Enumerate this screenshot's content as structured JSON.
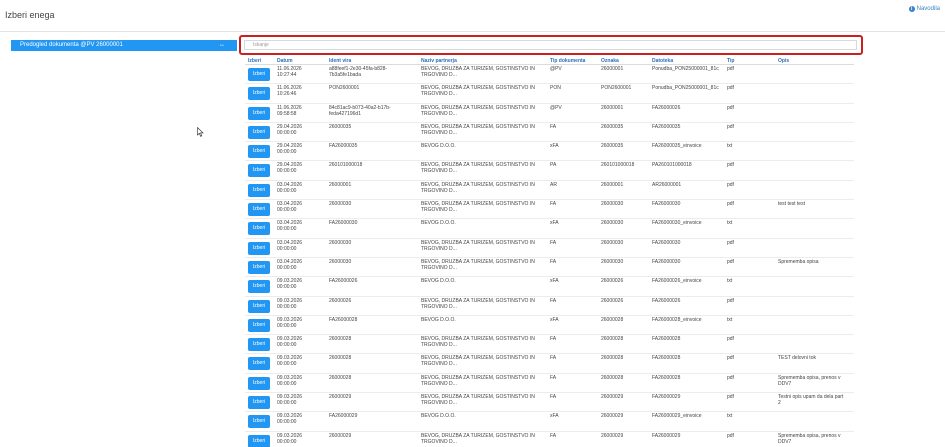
{
  "header": {
    "title": "Izberi enega",
    "help_label": "Navodila"
  },
  "preview": {
    "label": "Predogled dokumenta @PV 26000001",
    "arrows": "↔"
  },
  "search": {
    "placeholder": "Iskanje"
  },
  "table": {
    "columns": [
      "Izberi",
      "Datum",
      "Ident vira",
      "Naziv partnerja",
      "Tip dokumenta",
      "Oznaka",
      "Datoteka",
      "Tip",
      "Opis"
    ],
    "button_label": "Izberi",
    "rows": [
      {
        "date": "11.06.2026\n10:27:44",
        "ident": "a88feef1-2e30-45fa-b828-\n7b3a5fe1bada",
        "partner": "BEVOG, DRUŽBA ZA TURIZEM, GOSTINSTVO IN\nTRGOVINO D...",
        "tip": "@PV",
        "oznaka": "26000001",
        "datoteka": "Ponudba_PON25000001_81c",
        "tip2": "pdf",
        "opis": ""
      },
      {
        "date": "11.06.2026\n10:26:46",
        "ident": "PON2600001",
        "partner": "BEVOG, DRUŽBA ZA TURIZEM, GOSTINSTVO IN\nTRGOVINO D...",
        "tip": "PON",
        "oznaka": "PON2600001",
        "datoteka": "Ponudba_PON25000001_81c",
        "tip2": "pdf",
        "opis": ""
      },
      {
        "date": "11.06.2026\n09:58:58",
        "ident": "84c81ac9-b073-40a2-b17b-\nfeda427196d1",
        "partner": "BEVOG, DRUŽBA ZA TURIZEM, GOSTINSTVO IN\nTRGOVINO D...",
        "tip": "@PV",
        "oznaka": "26000001",
        "datoteka": "FA26000026",
        "tip2": "pdf",
        "opis": ""
      },
      {
        "date": "29.04.2026\n00:00:00",
        "ident": "26000035",
        "partner": "BEVOG, DRUŽBA ZA TURIZEM, GOSTINSTVO IN\nTRGOVINO D...",
        "tip": "FA",
        "oznaka": "26000035",
        "datoteka": "FA26000035",
        "tip2": "pdf",
        "opis": ""
      },
      {
        "date": "29.04.2026\n00:00:00",
        "ident": "FA26000035",
        "partner": "BEVOG D.O.O.",
        "tip": "xFA",
        "oznaka": "26000035",
        "datoteka": "FA26000035_einvoice",
        "tip2": "txt",
        "opis": ""
      },
      {
        "date": "29.04.2026\n00:00:00",
        "ident": "260101000018",
        "partner": "BEVOG, DRUŽBA ZA TURIZEM, GOSTINSTVO IN\nTRGOVINO D...",
        "tip": "PA",
        "oznaka": "260101000018",
        "datoteka": "PA260101000018",
        "tip2": "pdf",
        "opis": ""
      },
      {
        "date": "03.04.2026\n00:00:00",
        "ident": "26000001",
        "partner": "BEVOG, DRUŽBA ZA TURIZEM, GOSTINSTVO IN\nTRGOVINO D...",
        "tip": "AR",
        "oznaka": "26000001",
        "datoteka": "AR26000001",
        "tip2": "pdf",
        "opis": ""
      },
      {
        "date": "03.04.2026\n00:00:00",
        "ident": "26000030",
        "partner": "BEVOG, DRUŽBA ZA TURIZEM, GOSTINSTVO IN\nTRGOVINO D...",
        "tip": "FA",
        "oznaka": "26000030",
        "datoteka": "FA26000030",
        "tip2": "pdf",
        "opis": "test test test"
      },
      {
        "date": "03.04.2026\n00:00:00",
        "ident": "FA26000030",
        "partner": "BEVOG D.O.O.",
        "tip": "xFA",
        "oznaka": "26000030",
        "datoteka": "FA26000030_einvoice",
        "tip2": "txt",
        "opis": ""
      },
      {
        "date": "03.04.2026\n00:00:00",
        "ident": "26000030",
        "partner": "BEVOG, DRUŽBA ZA TURIZEM, GOSTINSTVO IN\nTRGOVINO D...",
        "tip": "FA",
        "oznaka": "26000030",
        "datoteka": "FA26000030",
        "tip2": "pdf",
        "opis": ""
      },
      {
        "date": "03.04.2026\n00:00:00",
        "ident": "26000030",
        "partner": "BEVOG, DRUŽBA ZA TURIZEM, GOSTINSTVO IN\nTRGOVINO D...",
        "tip": "FA",
        "oznaka": "26000030",
        "datoteka": "FA26000030",
        "tip2": "pdf",
        "opis": "Sprememba opisa"
      },
      {
        "date": "09.03.2026\n00:00:00",
        "ident": "FA26000026",
        "partner": "BEVOG D.O.O.",
        "tip": "xFA",
        "oznaka": "26000026",
        "datoteka": "FA26000026_einvoice",
        "tip2": "txt",
        "opis": ""
      },
      {
        "date": "09.03.2026\n00:00:00",
        "ident": "26000026",
        "partner": "BEVOG, DRUŽBA ZA TURIZEM, GOSTINSTVO IN\nTRGOVINO D...",
        "tip": "FA",
        "oznaka": "26000026",
        "datoteka": "FA26000026",
        "tip2": "pdf",
        "opis": ""
      },
      {
        "date": "09.03.2026\n00:00:00",
        "ident": "FA26000028",
        "partner": "BEVOG D.O.O.",
        "tip": "xFA",
        "oznaka": "26000028",
        "datoteka": "FA26000028_einvoice",
        "tip2": "txt",
        "opis": ""
      },
      {
        "date": "09.03.2026\n00:00:00",
        "ident": "26000028",
        "partner": "BEVOG, DRUŽBA ZA TURIZEM, GOSTINSTVO IN\nTRGOVINO D...",
        "tip": "FA",
        "oznaka": "26000028",
        "datoteka": "FA26000028",
        "tip2": "pdf",
        "opis": ""
      },
      {
        "date": "09.03.2026\n00:00:00",
        "ident": "26000028",
        "partner": "BEVOG, DRUŽBA ZA TURIZEM, GOSTINSTVO IN\nTRGOVINO D...",
        "tip": "FA",
        "oznaka": "26000028",
        "datoteka": "FA26000028",
        "tip2": "pdf",
        "opis": "TEST delovni tok"
      },
      {
        "date": "09.03.2026\n00:00:00",
        "ident": "26000028",
        "partner": "BEVOG, DRUŽBA ZA TURIZEM, GOSTINSTVO IN\nTRGOVINO D...",
        "tip": "FA",
        "oznaka": "26000028",
        "datoteka": "FA26000028",
        "tip2": "pdf",
        "opis": "Sprememba opisa, prenos v\nDDV7"
      },
      {
        "date": "09.03.2026\n00:00:00",
        "ident": "26000029",
        "partner": "BEVOG, DRUŽBA ZA TURIZEM, GOSTINSTVO IN\nTRGOVINO D...",
        "tip": "FA",
        "oznaka": "26000029",
        "datoteka": "FA26000029",
        "tip2": "pdf",
        "opis": "Testni opis upam da dela part\n2"
      },
      {
        "date": "09.03.2026\n00:00:00",
        "ident": "FA26000029",
        "partner": "BEVOG D.O.O.",
        "tip": "xFA",
        "oznaka": "26000029",
        "datoteka": "FA26000029_einvoice",
        "tip2": "txt",
        "opis": ""
      },
      {
        "date": "09.03.2026\n00:00:00",
        "ident": "26000029",
        "partner": "BEVOG, DRUŽBA ZA TURIZEM, GOSTINSTVO IN\nTRGOVINO D...",
        "tip": "FA",
        "oznaka": "26000029",
        "datoteka": "FA26000029",
        "tip2": "pdf",
        "opis": "Sprememba opisa, prenos v\nDDV7"
      }
    ]
  }
}
